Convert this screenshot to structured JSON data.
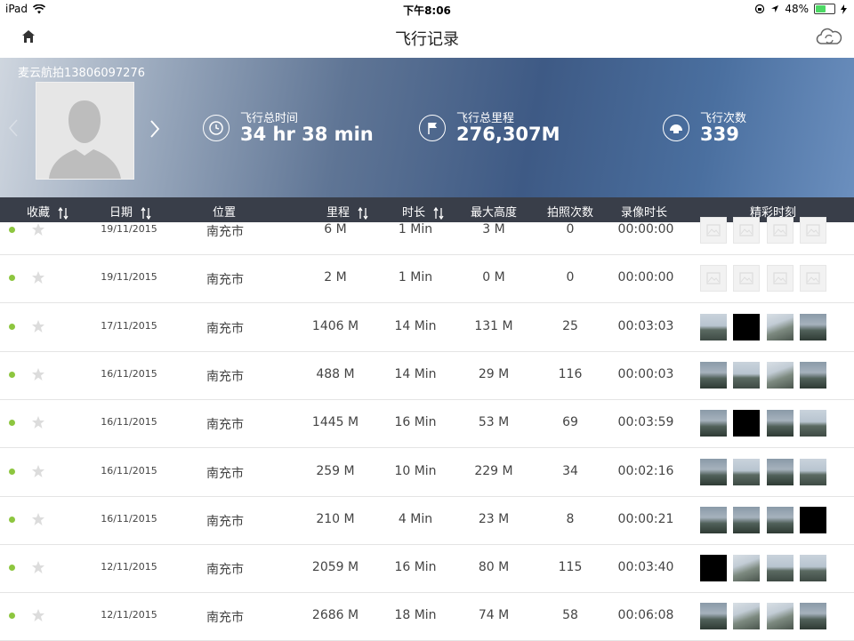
{
  "status_bar": {
    "device": "iPad",
    "time": "下午8:06",
    "battery": "48%"
  },
  "nav": {
    "title": "飞行记录",
    "home_icon": "home-icon",
    "sync_icon": "cloud-sync-icon"
  },
  "profile": {
    "username": "麦云航拍13806097276"
  },
  "stats": [
    {
      "label": "飞行总时间",
      "value": "34 hr 38 min",
      "icon": "clock-icon"
    },
    {
      "label": "飞行总里程",
      "value": "276,307M",
      "icon": "flag-icon"
    },
    {
      "label": "飞行次数",
      "value": "339",
      "icon": "drone-icon"
    }
  ],
  "columns": {
    "favorite": "收藏",
    "date": "日期",
    "location": "位置",
    "distance": "里程",
    "duration": "时长",
    "max_altitude": "最大高度",
    "photos": "拍照次数",
    "video": "录像时长",
    "highlights": "精彩时刻"
  },
  "colors": {
    "status_dot": "#8dc63f",
    "header_bg": "#282e3a"
  },
  "rows": [
    {
      "date": "19/11/2015",
      "location": "南充市",
      "distance": "6 M",
      "duration": "1 Min",
      "altitude": "3 M",
      "photos": "0",
      "video": "00:00:00",
      "thumbs": [
        "empty",
        "empty",
        "empty",
        "empty"
      ]
    },
    {
      "date": "19/11/2015",
      "location": "南充市",
      "distance": "2 M",
      "duration": "1 Min",
      "altitude": "0 M",
      "photos": "0",
      "video": "00:00:00",
      "thumbs": [
        "empty",
        "empty",
        "empty",
        "empty"
      ]
    },
    {
      "date": "17/11/2015",
      "location": "南充市",
      "distance": "1406 M",
      "duration": "14 Min",
      "altitude": "131 M",
      "photos": "25",
      "video": "00:03:03",
      "thumbs": [
        "photo",
        "black",
        "photo3",
        "photo2"
      ]
    },
    {
      "date": "16/11/2015",
      "location": "南充市",
      "distance": "488 M",
      "duration": "14 Min",
      "altitude": "29 M",
      "photos": "116",
      "video": "00:00:03",
      "thumbs": [
        "photo2",
        "photo",
        "photo3",
        "photo2"
      ]
    },
    {
      "date": "16/11/2015",
      "location": "南充市",
      "distance": "1445 M",
      "duration": "16 Min",
      "altitude": "53 M",
      "photos": "69",
      "video": "00:03:59",
      "thumbs": [
        "photo2",
        "black",
        "photo2",
        "photo"
      ]
    },
    {
      "date": "16/11/2015",
      "location": "南充市",
      "distance": "259 M",
      "duration": "10 Min",
      "altitude": "229 M",
      "photos": "34",
      "video": "00:02:16",
      "thumbs": [
        "photo2",
        "photo",
        "photo2",
        "photo"
      ]
    },
    {
      "date": "16/11/2015",
      "location": "南充市",
      "distance": "210 M",
      "duration": "4 Min",
      "altitude": "23 M",
      "photos": "8",
      "video": "00:00:21",
      "thumbs": [
        "photo2",
        "photo2",
        "photo2",
        "black"
      ]
    },
    {
      "date": "12/11/2015",
      "location": "南充市",
      "distance": "2059 M",
      "duration": "16 Min",
      "altitude": "80 M",
      "photos": "115",
      "video": "00:03:40",
      "thumbs": [
        "black",
        "photo3",
        "photo",
        "photo"
      ]
    },
    {
      "date": "12/11/2015",
      "location": "南充市",
      "distance": "2686 M",
      "duration": "18 Min",
      "altitude": "74 M",
      "photos": "58",
      "video": "00:06:08",
      "thumbs": [
        "photo2",
        "photo3",
        "photo3",
        "photo2"
      ]
    }
  ]
}
